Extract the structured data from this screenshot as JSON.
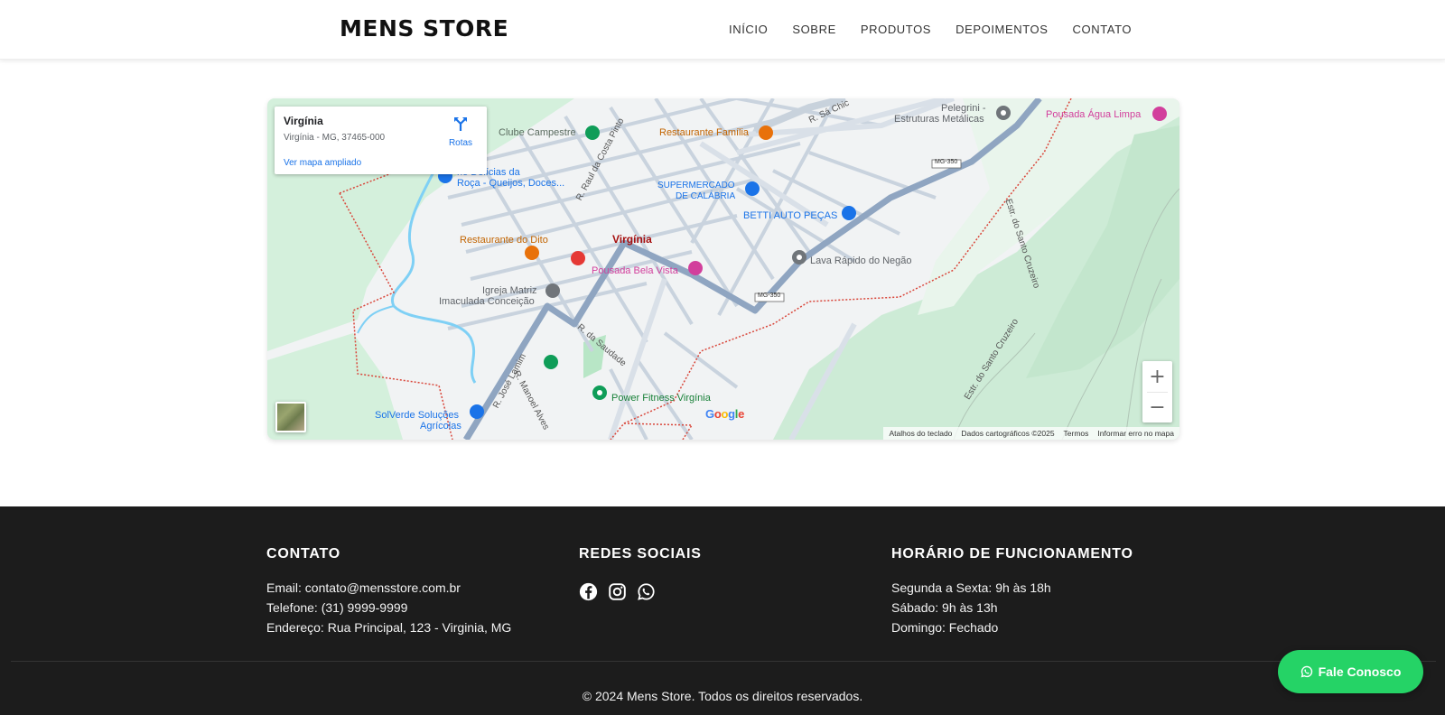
{
  "header": {
    "logo": "MENS STORE",
    "nav": [
      "INÍCIO",
      "SOBRE",
      "PRODUTOS",
      "DEPOIMENTOS",
      "CONTATO"
    ]
  },
  "map": {
    "card": {
      "title": "Virgínia",
      "address": "Virgínia - MG, 37465-000",
      "link": "Ver mapa ampliado",
      "directions": "Rotas"
    },
    "labels": {
      "town": "Virgínia",
      "clube": "Clube Campestre",
      "restaurante_familia": "Restaurante Família",
      "pelegrini_1": "Pelegrini -",
      "pelegrini_2": "Estruturas Metálicas",
      "pousada_agua": "Pousada Água Limpa",
      "delicias_1": "rio Delícias da",
      "delicias_2": "Roça - Queijos, Doces...",
      "supermercado_1": "SUPERMERCADO",
      "supermercado_2": "DE CALÁBRIA",
      "betti": "BETTI AUTO PEÇAS",
      "restaurante_dito": "Restaurante do Dito",
      "pousada_bela": "Pousada Bela Vista",
      "lava_rapido": "Lava Rápido do Negão",
      "igreja_1": "Igreja Matriz",
      "igreja_2": "Imaculada Conceição",
      "power": "Power Fitness Virgínia",
      "solverde_1": "SolVerde Soluções",
      "solverde_2": "Agrícolas",
      "r_raul": "R. Raul da Costa Pinto",
      "r_sa": "R. Sá Chic",
      "r_saudade": "R. da Saudade",
      "r_jose": "R. José Lamim",
      "r_manoel": "R. Manoel Alves",
      "estr_santo_1": "Estr. do Santo Cruzeiro",
      "estr_santo_2": "Estr. do Santo Cruzeiro",
      "mg350_a": "MG-350",
      "mg350_b": "MG-350"
    },
    "google": "Google",
    "footer": [
      "Atalhos do teclado",
      "Dados cartográficos ©2025",
      "Termos",
      "Informar erro no mapa"
    ],
    "zoom_in": "+",
    "zoom_out": "−"
  },
  "footer": {
    "contato": {
      "title": "CONTATO",
      "email": "Email: contato@mensstore.com.br",
      "telefone": "Telefone: (31) 9999-9999",
      "endereco": "Endereço: Rua Principal, 123 - Virginia, MG"
    },
    "redes": {
      "title": "REDES SOCIAIS",
      "icons": [
        "facebook-icon",
        "instagram-icon",
        "whatsapp-icon"
      ]
    },
    "horario": {
      "title": "HORÁRIO DE FUNCIONAMENTO",
      "semana": "Segunda a Sexta: 9h às 18h",
      "sabado": "Sábado: 9h às 13h",
      "domingo": "Domingo: Fechado"
    },
    "copyright": "© 2024 Mens Store. Todos os direitos reservados."
  },
  "fale_conosco": "Fale Conosco",
  "colors": {
    "footer_bg": "#1c1c1c",
    "whatsapp": "#25d366",
    "map_link": "#1a73e8",
    "park": "#c9ecd5",
    "road_major": "#8fa5c1"
  }
}
